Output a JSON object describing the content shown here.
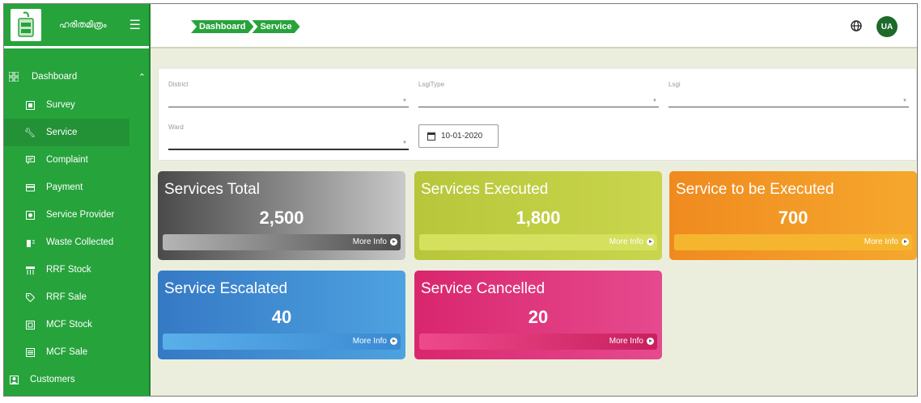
{
  "brand": {
    "name": "ഹരിതമിത്രം"
  },
  "sidebar": {
    "dashboard_label": "Dashboard",
    "items": [
      {
        "label": "Survey",
        "icon": "survey-icon"
      },
      {
        "label": "Service",
        "icon": "wrench-icon"
      },
      {
        "label": "Complaint",
        "icon": "complaint-icon"
      },
      {
        "label": "Payment",
        "icon": "card-icon"
      },
      {
        "label": "Service Provider",
        "icon": "provider-icon"
      },
      {
        "label": "Waste Collected",
        "icon": "waste-icon"
      },
      {
        "label": "RRF Stock",
        "icon": "stock-icon"
      },
      {
        "label": "RRF Sale",
        "icon": "tag-icon"
      },
      {
        "label": "MCF Stock",
        "icon": "mcf-stock-icon"
      },
      {
        "label": "MCF Sale",
        "icon": "mcf-sale-icon"
      }
    ],
    "customers_label": "Customers"
  },
  "header": {
    "breadcrumb": [
      "Dashboard",
      "Service"
    ],
    "avatar_initials": "UA"
  },
  "filters": {
    "district_label": "District",
    "lsgi_type_label": "LsgiType",
    "lsgi_label": "Lsgi",
    "ward_label": "Ward",
    "date": "10-01-2020"
  },
  "cards": [
    {
      "title": "Services Total",
      "value": "2,500",
      "more": "More Info"
    },
    {
      "title": "Services Executed",
      "value": "1,800",
      "more": "More Info"
    },
    {
      "title": "Service to be Executed",
      "value": "700",
      "more": "More Info"
    },
    {
      "title": "Service Escalated",
      "value": "40",
      "more": "More Info"
    },
    {
      "title": "Service Cancelled",
      "value": "20",
      "more": "More Info"
    }
  ],
  "colors": {
    "sidebar_green": "#27a33c",
    "background": "#eceedd",
    "total": "#5a5a5a",
    "executed": "#bfcd42",
    "to_be_executed": "#f39526",
    "escalated": "#3f8ed3",
    "cancelled": "#e03a7e"
  }
}
